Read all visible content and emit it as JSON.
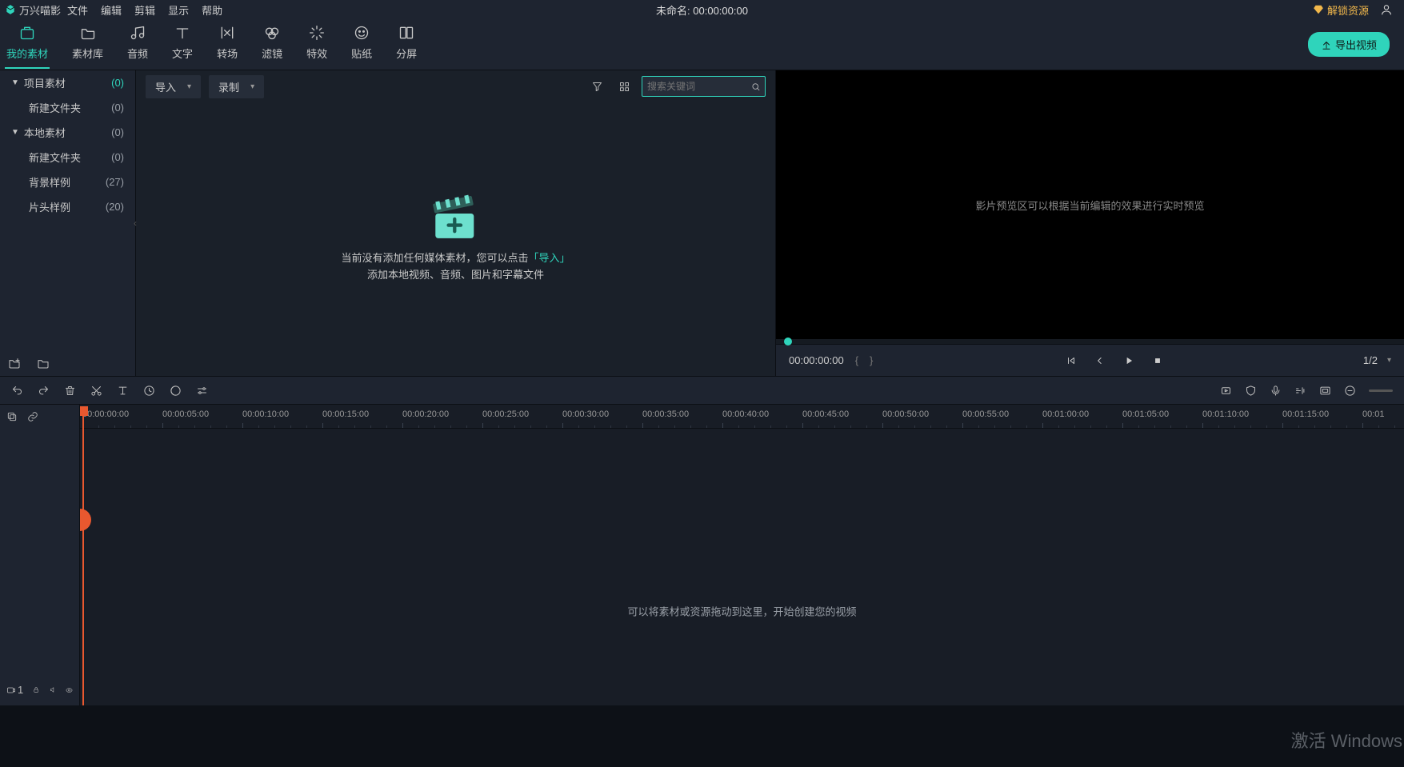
{
  "app_name": "万兴喵影",
  "menu": [
    "文件",
    "编辑",
    "剪辑",
    "显示",
    "帮助"
  ],
  "center_title": "未命名: 00:00:00:00",
  "unlock_label": "解锁资源",
  "ribbon_tabs": [
    {
      "label": "我的素材"
    },
    {
      "label": "素材库"
    },
    {
      "label": "音频"
    },
    {
      "label": "文字"
    },
    {
      "label": "转场"
    },
    {
      "label": "滤镜"
    },
    {
      "label": "特效"
    },
    {
      "label": "贴纸"
    },
    {
      "label": "分屏"
    }
  ],
  "export_label": "导出视频",
  "tree": [
    {
      "label": "项目素材",
      "count": "(0)",
      "top": true,
      "expand": true
    },
    {
      "label": "新建文件夹",
      "count": "(0)",
      "child": true
    },
    {
      "label": "本地素材",
      "count": "(0)",
      "top": true,
      "expand": true
    },
    {
      "label": "新建文件夹",
      "count": "(0)",
      "child": true
    },
    {
      "label": "背景样例",
      "count": "(27)",
      "child": true
    },
    {
      "label": "片头样例",
      "count": "(20)",
      "child": true
    }
  ],
  "import_dropdown": "导入",
  "record_dropdown": "录制",
  "search_placeholder": "搜索关键词",
  "empty_line1": "当前没有添加任何媒体素材，您可以点击",
  "empty_import": "「导入」",
  "empty_line2": "添加本地视频、音频、图片和字幕文件",
  "preview_hint": "影片预览区可以根据当前编辑的效果进行实时预览",
  "play_time": "00:00:00:00",
  "ratio": "1/2",
  "ruler_labels": [
    "00:00:00:00",
    "00:00:05:00",
    "00:00:10:00",
    "00:00:15:00",
    "00:00:20:00",
    "00:00:25:00",
    "00:00:30:00",
    "00:00:35:00",
    "00:00:40:00",
    "00:00:45:00",
    "00:00:50:00",
    "00:00:55:00",
    "00:01:00:00",
    "00:01:05:00",
    "00:01:10:00",
    "00:01:15:00",
    "00:01"
  ],
  "timeline_hint": "可以将素材或资源拖动到这里，开始创建您的视频",
  "track_badge": "1",
  "activate": "激活 Windows"
}
